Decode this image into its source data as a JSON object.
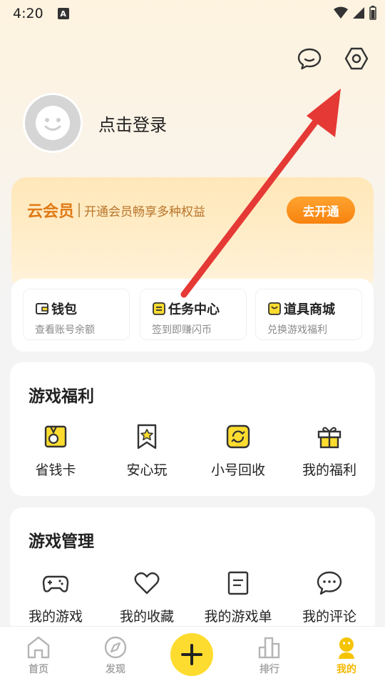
{
  "status": {
    "time": "4:20",
    "badge": "A"
  },
  "header": {
    "message_icon": "chat-bubble-icon",
    "settings_icon": "hexagon-settings-icon"
  },
  "profile": {
    "login_label": "点击登录"
  },
  "vip": {
    "title": "云会员",
    "desc": "开通会员畅享多种权益",
    "button": "去开通",
    "accent": "#e07a14"
  },
  "quick": [
    {
      "title": "钱包",
      "sub": "查看账号余额",
      "icon": "wallet-icon"
    },
    {
      "title": "任务中心",
      "sub": "签到即赚闪币",
      "icon": "task-icon"
    },
    {
      "title": "道具商城",
      "sub": "兑换游戏福利",
      "icon": "shop-bag-icon"
    }
  ],
  "welfare": {
    "title": "游戏福利",
    "items": [
      {
        "label": "省钱卡",
        "icon": "coin-card-icon"
      },
      {
        "label": "安心玩",
        "icon": "star-bookmark-icon"
      },
      {
        "label": "小号回收",
        "icon": "recycle-icon"
      },
      {
        "label": "我的福利",
        "icon": "gift-icon"
      }
    ]
  },
  "manage": {
    "title": "游戏管理",
    "items": [
      {
        "label": "我的游戏",
        "icon": "gamepad-icon"
      },
      {
        "label": "我的收藏",
        "icon": "heart-icon"
      },
      {
        "label": "我的游戏单",
        "icon": "list-doc-icon"
      },
      {
        "label": "我的评论",
        "icon": "comment-icon"
      }
    ]
  },
  "tabs": [
    {
      "label": "首页",
      "icon": "home-icon"
    },
    {
      "label": "发现",
      "icon": "compass-icon"
    },
    {
      "label": "",
      "icon": "plus-icon"
    },
    {
      "label": "排行",
      "icon": "ranking-icon"
    },
    {
      "label": "我的",
      "icon": "me-icon"
    }
  ],
  "colors": {
    "brand_yellow": "#fedc2f",
    "active_tab": "#f5b800",
    "arrow": "#e53935"
  }
}
